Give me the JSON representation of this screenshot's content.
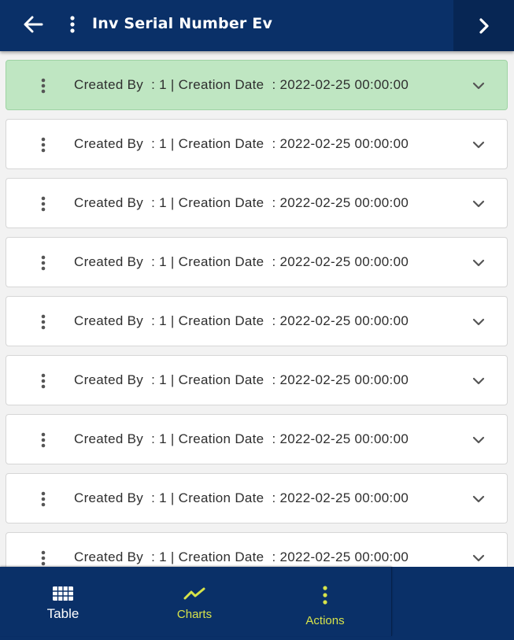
{
  "header": {
    "title": "Inv Serial Number Ev",
    "back_icon": "arrow-left-icon",
    "menu_icon": "kebab-icon",
    "next_icon": "chevron-right-icon"
  },
  "colors": {
    "header_bg": "#0a3068",
    "selected_row_bg": "#bfe6c2",
    "accent": "#d7e34a"
  },
  "rows": [
    {
      "text": "Created By  : 1 | Creation Date  : 2022-02-25 00:00:00",
      "selected": true
    },
    {
      "text": "Created By  : 1 | Creation Date  : 2022-02-25 00:00:00",
      "selected": false
    },
    {
      "text": "Created By  : 1 | Creation Date  : 2022-02-25 00:00:00",
      "selected": false
    },
    {
      "text": "Created By  : 1 | Creation Date  : 2022-02-25 00:00:00",
      "selected": false
    },
    {
      "text": "Created By  : 1 | Creation Date  : 2022-02-25 00:00:00",
      "selected": false
    },
    {
      "text": "Created By  : 1 | Creation Date  : 2022-02-25 00:00:00",
      "selected": false
    },
    {
      "text": "Created By  : 1 | Creation Date  : 2022-02-25 00:00:00",
      "selected": false
    },
    {
      "text": "Created By  : 1 | Creation Date  : 2022-02-25 00:00:00",
      "selected": false
    },
    {
      "text": "Created By  : 1 | Creation Date  : 2022-02-25 00:00:00",
      "selected": false
    }
  ],
  "bottom_nav": {
    "table_label": "Table",
    "charts_label": "Charts",
    "actions_label": "Actions"
  }
}
